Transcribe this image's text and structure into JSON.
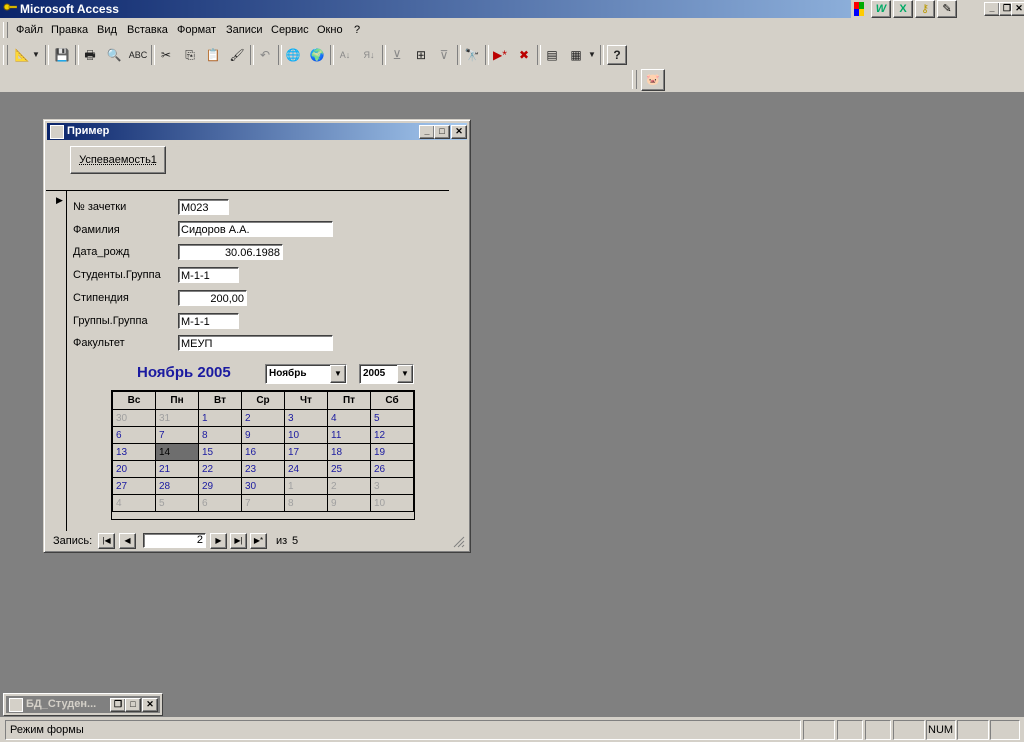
{
  "app": {
    "title": "Microsoft Access"
  },
  "menu": [
    "Файл",
    "Правка",
    "Вид",
    "Вставка",
    "Формат",
    "Записи",
    "Сервис",
    "Окно",
    "?"
  ],
  "form": {
    "title": "Пример",
    "button_label": "Успеваемость1",
    "fields": [
      {
        "label": "№ зачетки",
        "value": "М023"
      },
      {
        "label": "Фамилия",
        "value": "Сидоров А.А."
      },
      {
        "label": "Дата_рожд",
        "value": "30.06.1988"
      },
      {
        "label": "Студенты.Группа",
        "value": "М-1-1"
      },
      {
        "label": "Стипендия",
        "value": "200,00"
      },
      {
        "label": "Группы.Группа",
        "value": "М-1-1"
      },
      {
        "label": "Факультет",
        "value": "МЕУП"
      }
    ],
    "calendar": {
      "heading": "Ноябрь 2005",
      "month_select": "Ноябрь",
      "year_select": "2005",
      "weekdays": [
        "Вс",
        "Пн",
        "Вт",
        "Ср",
        "Чт",
        "Пт",
        "Сб"
      ],
      "weeks": [
        [
          "30",
          "31",
          "1",
          "2",
          "3",
          "4",
          "5"
        ],
        [
          "6",
          "7",
          "8",
          "9",
          "10",
          "11",
          "12"
        ],
        [
          "13",
          "14",
          "15",
          "16",
          "17",
          "18",
          "19"
        ],
        [
          "20",
          "21",
          "22",
          "23",
          "24",
          "25",
          "26"
        ],
        [
          "27",
          "28",
          "29",
          "30",
          "1",
          "2",
          "3"
        ],
        [
          "4",
          "5",
          "6",
          "7",
          "8",
          "9",
          "10"
        ]
      ],
      "selected_day": "14"
    },
    "record_nav": {
      "label": "Запись:",
      "current": "2",
      "of_label": "из",
      "total": "5"
    }
  },
  "minimized_window": {
    "title": "БД_Студен..."
  },
  "status": {
    "text": "Режим формы",
    "num": "NUM"
  }
}
